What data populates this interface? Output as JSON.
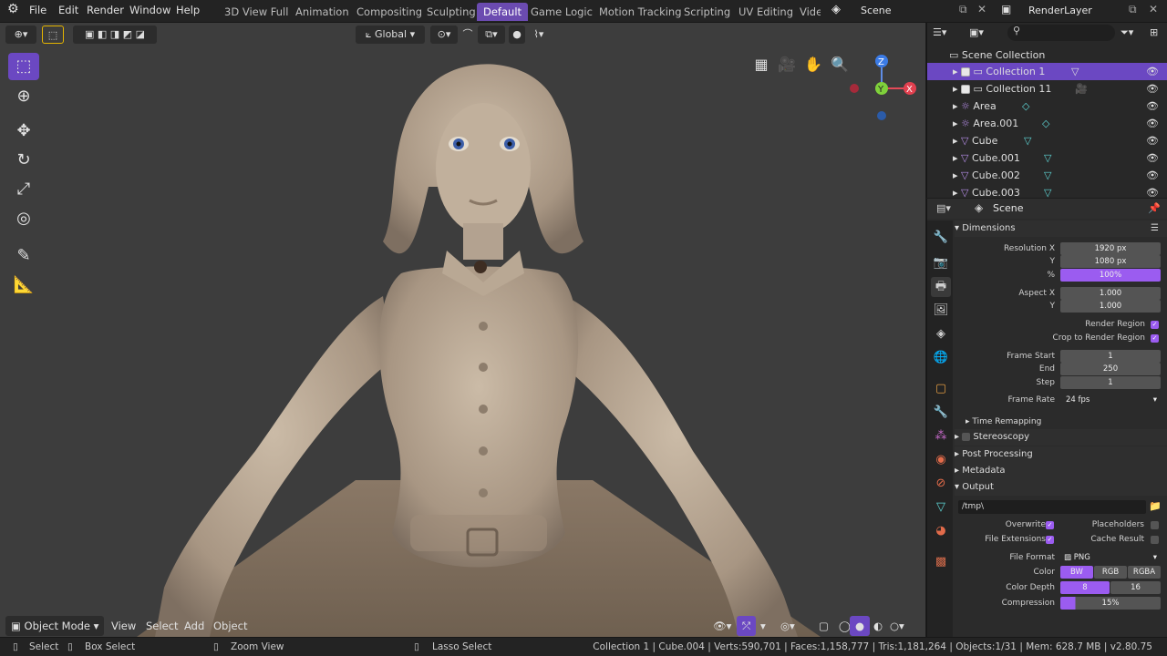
{
  "menubar": [
    "File",
    "Edit",
    "Render",
    "Window",
    "Help"
  ],
  "workspaces": [
    "3D View Full",
    "Animation",
    "Compositing",
    "Sculpting",
    "Default",
    "Game Logic",
    "Motion Tracking",
    "Scripting",
    "UV Editing",
    "Vide"
  ],
  "scene_name": "Scene",
  "render_layer": "RenderLayer",
  "viewport": {
    "transform_orientation": "Global",
    "mode": "Object Mode",
    "menus": [
      "View",
      "Select",
      "Add",
      "Object"
    ],
    "axis_labels": {
      "z": "Z",
      "y": "Y",
      "x": "X"
    }
  },
  "outliner": {
    "root": "Scene Collection",
    "items": [
      {
        "label": "Collection 1",
        "selected": true
      },
      {
        "label": "Collection 11",
        "selected": false
      },
      {
        "label": "Area",
        "selected": false
      },
      {
        "label": "Area.001",
        "selected": false
      },
      {
        "label": "Cube",
        "selected": false
      },
      {
        "label": "Cube.001",
        "selected": false
      },
      {
        "label": "Cube.002",
        "selected": false
      },
      {
        "label": "Cube.003",
        "selected": false
      }
    ]
  },
  "properties": {
    "context": "Scene",
    "dimensions": {
      "title": "Dimensions",
      "resolution_x_label": "Resolution X",
      "resolution_x": "1920 px",
      "y_label": "Y",
      "resolution_y": "1080 px",
      "pct_label": "%",
      "resolution_pct": "100%",
      "aspect_x_label": "Aspect X",
      "aspect_x": "1.000",
      "aspect_y": "1.000",
      "render_region": "Render Region",
      "crop_region": "Crop to Render Region",
      "frame_start_label": "Frame Start",
      "frame_start": "1",
      "end_label": "End",
      "frame_end": "250",
      "step_label": "Step",
      "frame_step": "1",
      "frame_rate_label": "Frame Rate",
      "frame_rate": "24 fps",
      "time_remapping": "Time Remapping"
    },
    "panels": [
      "Stereoscopy",
      "Post Processing",
      "Metadata"
    ],
    "output": {
      "title": "Output",
      "path": "/tmp\\",
      "overwrite": "Overwrite",
      "placeholders": "Placeholders",
      "file_extensions": "File Extensions",
      "cache_result": "Cache Result",
      "file_format_label": "File Format",
      "file_format": "PNG",
      "color_label": "Color",
      "color_options": [
        "BW",
        "RGB",
        "RGBA"
      ],
      "depth_label": "Color Depth",
      "depth_options": [
        "8",
        "16"
      ],
      "compression_label": "Compression",
      "compression": "15%"
    }
  },
  "statusbar": {
    "select": "Select",
    "box_select": "Box Select",
    "zoom_view": "Zoom View",
    "lasso_select": "Lasso Select",
    "info": "Collection 1 | Cube.004 | Verts:590,701 | Faces:1,158,777 | Tris:1,181,264 | Objects:1/31 | Mem: 628.7 MB | v2.80.75"
  },
  "colors": {
    "accent": "#6b48c2",
    "field": "#545454",
    "highlight": "#9b5cf0"
  }
}
